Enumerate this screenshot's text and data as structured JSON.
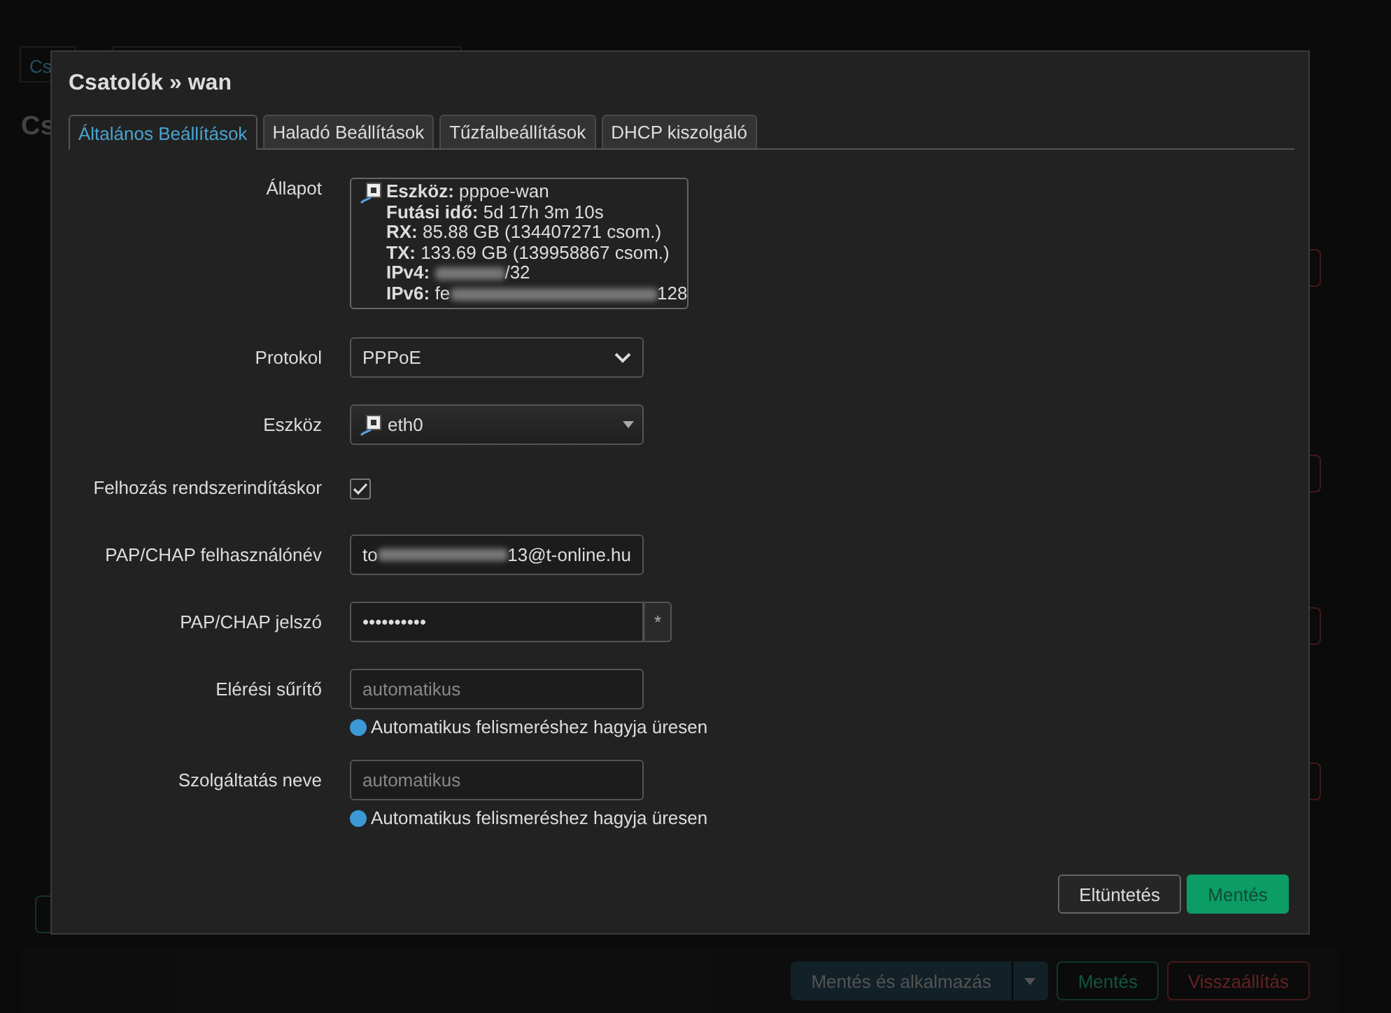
{
  "background": {
    "tab": "Cs",
    "heading": "Cs",
    "buttons": [
      {
        "label": "Mentés és alkalmazás",
        "kind": "apply"
      },
      {
        "label": "Mentés",
        "kind": "save"
      },
      {
        "label": "Visszaállítás",
        "kind": "reset"
      }
    ]
  },
  "dialog": {
    "title": "Csatolók » wan",
    "tabs": [
      {
        "label": "Általános Beállítások",
        "selected": true
      },
      {
        "label": "Haladó Beállítások",
        "selected": false
      },
      {
        "label": "Tűzfalbeállítások",
        "selected": false
      },
      {
        "label": "DHCP kiszolgáló",
        "selected": false
      }
    ],
    "status": {
      "label": "Állapot",
      "lines": [
        {
          "key": "Eszköz:",
          "value": "pppoe-wan"
        },
        {
          "key": "Futási idő:",
          "value": "5d 17h 3m 10s"
        },
        {
          "key": "RX:",
          "value": "85.88 GB (134407271 csom.)"
        },
        {
          "key": "TX:",
          "value": "133.69 GB (139958867 csom.)"
        },
        {
          "key": "IPv4:",
          "value_end": "/32"
        },
        {
          "key": "IPv6:",
          "value_start": "fe",
          "value_end": "128"
        }
      ]
    },
    "fields": [
      {
        "kind": "select",
        "label": "Protokol",
        "value": "PPPoE"
      },
      {
        "kind": "device",
        "label": "Eszköz",
        "value": "eth0"
      },
      {
        "kind": "checkbox",
        "label": "Felhozás rendszerindításkor",
        "checked": true
      },
      {
        "kind": "redacted",
        "label": "PAP/CHAP felhasználónév",
        "value_start": "to",
        "value_end": "13@t-online.hu"
      },
      {
        "kind": "password",
        "label": "PAP/CHAP jelszó",
        "value": "••••••••••",
        "reveal": "*"
      },
      {
        "kind": "text",
        "label": "Elérési sűrítő",
        "placeholder": "automatikus",
        "hint": "Automatikus felismeréshez hagyja üresen"
      },
      {
        "kind": "text",
        "label": "Szolgáltatás neve",
        "placeholder": "automatikus",
        "hint": "Automatikus felismeréshez hagyja üresen"
      }
    ],
    "buttons": [
      {
        "label": "Eltüntetés",
        "kind": "dismiss"
      },
      {
        "label": "Mentés",
        "kind": "save"
      }
    ]
  }
}
